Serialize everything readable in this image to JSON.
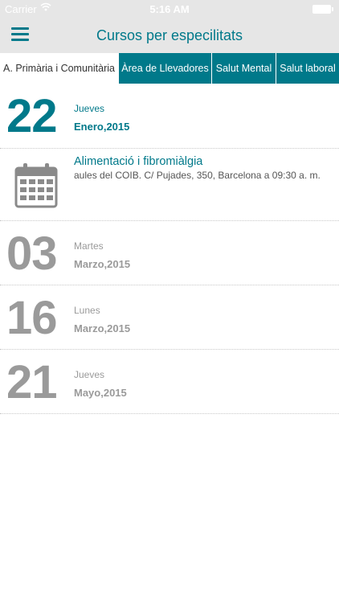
{
  "status_bar": {
    "carrier": "Carrier",
    "time": "5:16 AM",
    "wifi_icon": "wifi-icon",
    "battery_icon": "battery-icon"
  },
  "header": {
    "title": "Cursos per especilitats",
    "menu_icon": "hamburger-menu-icon"
  },
  "tabs": [
    {
      "label": "A. Primària i Comunitària",
      "active": true
    },
    {
      "label": "Àrea de Llevadores",
      "active": false
    },
    {
      "label": "Salut Mental",
      "active": false
    },
    {
      "label": "Salut laboral",
      "active": false
    }
  ],
  "dates": [
    {
      "day": "22",
      "weekday": "Jueves",
      "month_year": "Enero,2015"
    },
    {
      "day": "03",
      "weekday": "Martes",
      "month_year": "Marzo,2015"
    },
    {
      "day": "16",
      "weekday": "Lunes",
      "month_year": "Marzo,2015"
    },
    {
      "day": "21",
      "weekday": "Jueves",
      "month_year": "Mayo,2015"
    }
  ],
  "event": {
    "title": "Alimentació i fibromiàlgia",
    "place": "aules del COIB. C/ Pujades, 350, Barcelona a 09:30 a. m.",
    "icon": "calendar-icon"
  },
  "colors": {
    "accent": "#00798a",
    "muted": "#9a9a9a",
    "header_bg": "#e6e6e6"
  }
}
